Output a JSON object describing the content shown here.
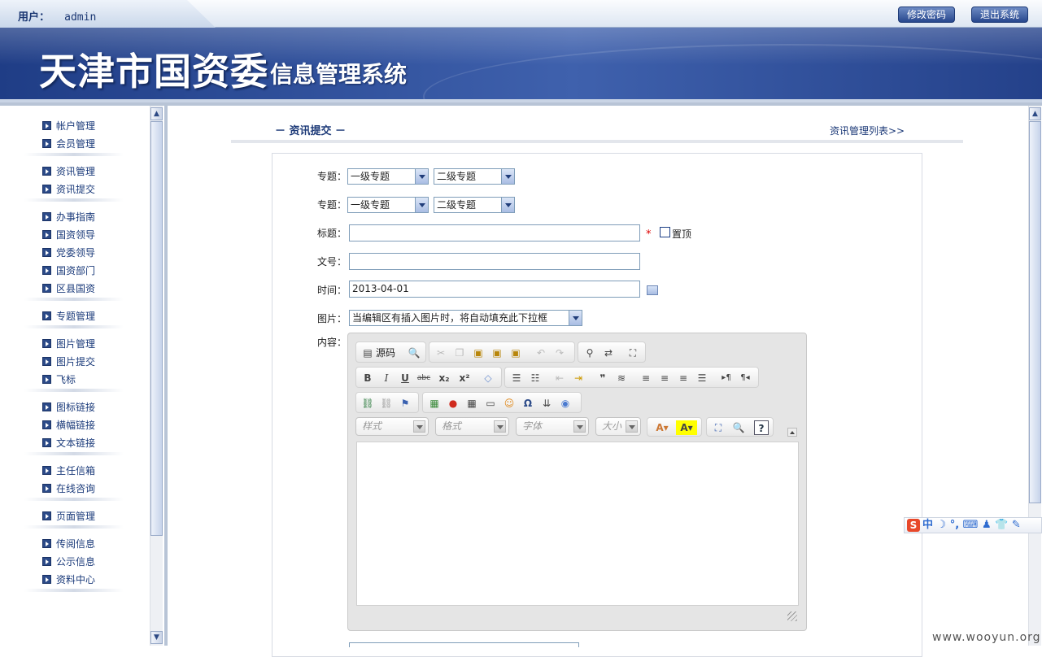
{
  "header": {
    "user_label": "用户：",
    "user_name": "admin",
    "change_password": "修改密码",
    "logout": "退出系统",
    "banner_title": "天津市国资委",
    "banner_subtitle": "信息管理系统"
  },
  "sidebar": {
    "groups": [
      [
        "帐户管理",
        "会员管理"
      ],
      [
        "资讯管理",
        "资讯提交"
      ],
      [
        "办事指南",
        "国资领导",
        "党委领导",
        "国资部门",
        "区县国资"
      ],
      [
        "专题管理"
      ],
      [
        "图片管理",
        "图片提交",
        "飞标"
      ],
      [
        "图标链接",
        "横幅链接",
        "文本链接"
      ],
      [
        "主任信箱",
        "在线咨询"
      ],
      [
        "页面管理"
      ],
      [
        "传阅信息",
        "公示信息",
        "资料中心"
      ]
    ]
  },
  "page": {
    "heading": "－ 资讯提交 －",
    "list_link": "资讯管理列表>>"
  },
  "form": {
    "topic_label": "专题：",
    "topic1_level1": "一级专题",
    "topic1_level2": "二级专题",
    "topic2_level1": "一级专题",
    "topic2_level2": "二级专题",
    "title_label": "标题：",
    "title_value": "",
    "required_mark": "*",
    "pin_label": "置顶",
    "docno_label": "文号：",
    "docno_value": "",
    "time_label": "时间：",
    "time_value": "2013-04-01",
    "image_label": "图片：",
    "image_select": "当编辑区有插入图片时，将自动填充此下拉框",
    "content_label": "内容："
  },
  "editor": {
    "source_label": "源码",
    "combo_style": "样式",
    "combo_format": "格式",
    "combo_font": "字体",
    "combo_size": "大小"
  },
  "ime": {
    "logo": "S",
    "text": "中 ☽ °, ⌨ ♟ 👕 ✎"
  },
  "watermark": "www.wooyun.org"
}
